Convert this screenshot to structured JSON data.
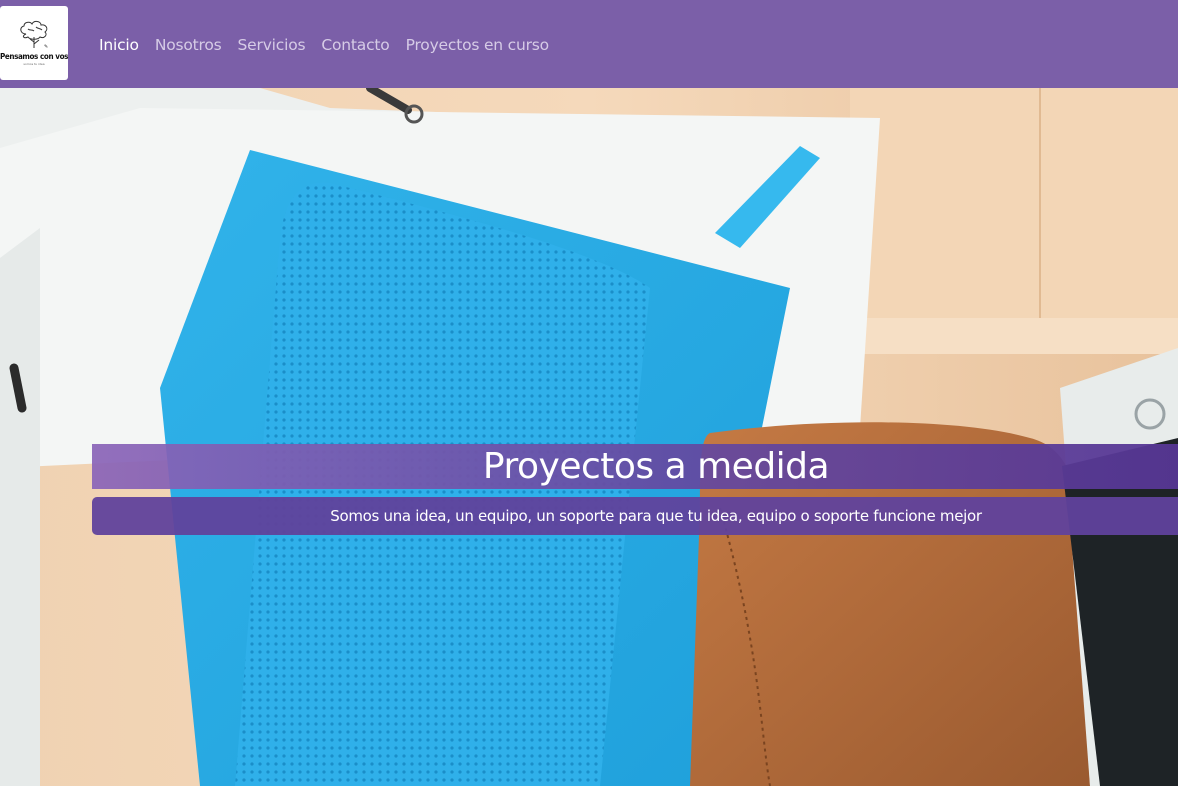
{
  "brand": {
    "name": "Pensamos con vos",
    "tagline": "somos tu idea",
    "logo_icon": "tree-brain-icon"
  },
  "nav": {
    "items": [
      {
        "label": "Inicio",
        "active": true
      },
      {
        "label": "Nosotros",
        "active": false
      },
      {
        "label": "Servicios",
        "active": false
      },
      {
        "label": "Contacto",
        "active": false
      },
      {
        "label": "Proyectos en curso",
        "active": false
      }
    ]
  },
  "hero": {
    "title": "Proyectos a medida",
    "subtitle": "Somos una idea, un equipo, un soporte para que tu idea, equipo o soporte funcione mejor",
    "background_image": "notebooks-and-leather-case-photo"
  },
  "colors": {
    "navbar": "#7b5fa8",
    "band": "#6448a0",
    "nav_inactive": "#d6cbe6",
    "nav_active": "#ffffff"
  }
}
